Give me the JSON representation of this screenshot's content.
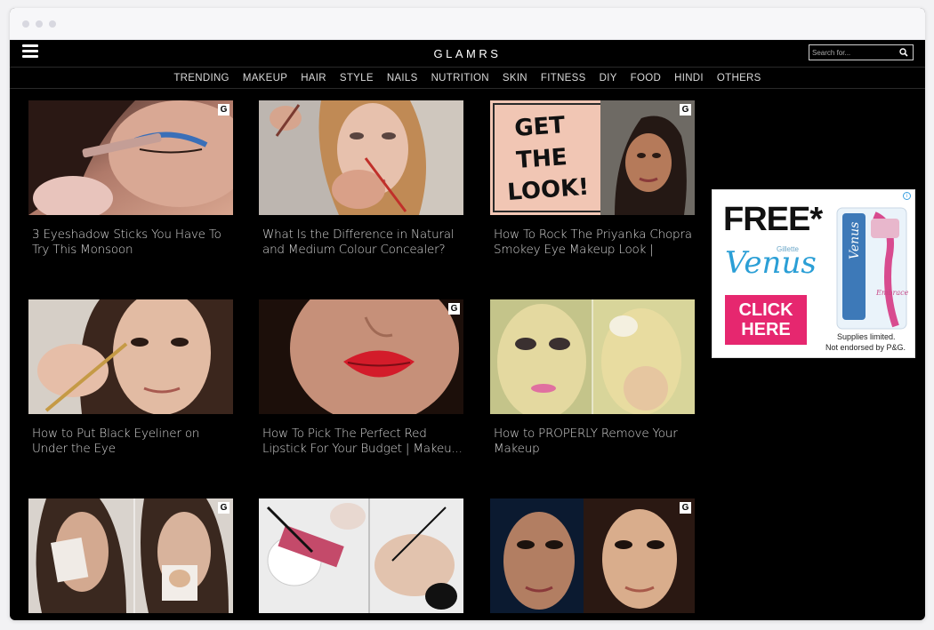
{
  "header": {
    "logo": "GLAMRS",
    "search_placeholder": "Search for..."
  },
  "nav": [
    "TRENDING",
    "MAKEUP",
    "HAIR",
    "STYLE",
    "NAILS",
    "NUTRITION",
    "SKIN",
    "FITNESS",
    "DIY",
    "FOOD",
    "HINDI",
    "OTHERS"
  ],
  "cards": [
    {
      "title": "3 Eyeshadow Sticks You Have To Try This Monsoon",
      "badge": "G"
    },
    {
      "title": "What Is the Difference in Natural and Medium Colour Concealer?",
      "badge": ""
    },
    {
      "title": "How To Rock The Priyanka Chopra Smokey Eye Makeup Look |",
      "badge": "G",
      "overlay": "GET THE LOOK!"
    },
    {
      "title": "How to Put Black Eyeliner on Under the Eye",
      "badge": ""
    },
    {
      "title": "How To Pick The Perfect Red Lipstick For Your Budget | Makeu...",
      "badge": "G"
    },
    {
      "title": "How to PROPERLY Remove Your Makeup",
      "badge": ""
    },
    {
      "title": "",
      "badge": "G"
    },
    {
      "title": "",
      "badge": ""
    },
    {
      "title": "",
      "badge": "G"
    }
  ],
  "ad": {
    "headline": "FREE*",
    "brand": "Venus",
    "sub_brand": "Gillette",
    "cta": "CLICK HERE",
    "fine1": "Supplies limited.",
    "fine2": "Not endorsed by P&G.",
    "product_text": "Venus",
    "product_sub": "Embrace"
  }
}
